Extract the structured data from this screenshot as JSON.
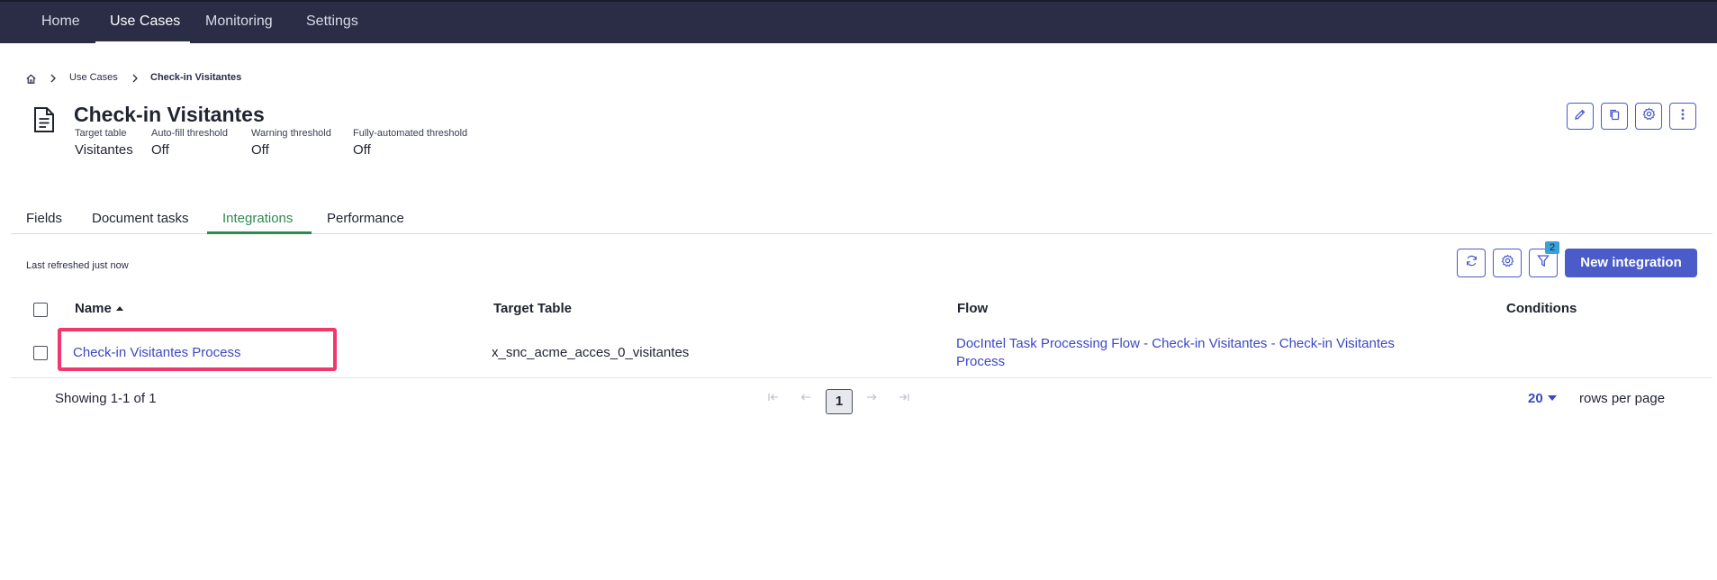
{
  "nav": {
    "items": [
      {
        "label": "Home"
      },
      {
        "label": "Use Cases"
      },
      {
        "label": "Monitoring"
      },
      {
        "label": "Settings"
      }
    ],
    "active": "Use Cases"
  },
  "breadcrumb": {
    "home_icon": "home-icon",
    "items": [
      "Use Cases",
      "Check-in Visitantes"
    ]
  },
  "header": {
    "icon": "document-icon",
    "title": "Check-in Visitantes",
    "meta": [
      {
        "label": "Target table",
        "value": "Visitantes"
      },
      {
        "label": "Auto-fill threshold",
        "value": "Off"
      },
      {
        "label": "Warning threshold",
        "value": "Off"
      },
      {
        "label": "Fully-automated threshold",
        "value": "Off"
      }
    ],
    "actions": [
      "edit-icon",
      "copy-icon",
      "gear-icon",
      "more-vertical-icon"
    ]
  },
  "tabs": {
    "items": [
      "Fields",
      "Document tasks",
      "Integrations",
      "Performance"
    ],
    "active": "Integrations"
  },
  "toolbar": {
    "refreshed": "Last refreshed just now",
    "filter_count": "2",
    "new_button": "New integration"
  },
  "table": {
    "columns": [
      "Name",
      "Target Table",
      "Flow",
      "Conditions"
    ],
    "sort": {
      "column": "Name",
      "direction": "ascending"
    },
    "rows": [
      {
        "name": "Check-in Visitantes Process",
        "target_table": "x_snc_acme_acces_0_visitantes",
        "flow": "DocIntel Task Processing Flow - Check-in Visitantes - Check-in Visitantes Process",
        "conditions": ""
      }
    ]
  },
  "pagination": {
    "showing": "Showing 1-1 of 1",
    "current_page": "1",
    "rows_per_page": "20",
    "rows_per_page_label": "rows per page"
  },
  "colors": {
    "nav_bg": "#2a2d45",
    "accent": "#4b5bc9",
    "link": "#3a49c4",
    "active_tab": "#2d8a4e",
    "highlight": "#f0386e"
  }
}
